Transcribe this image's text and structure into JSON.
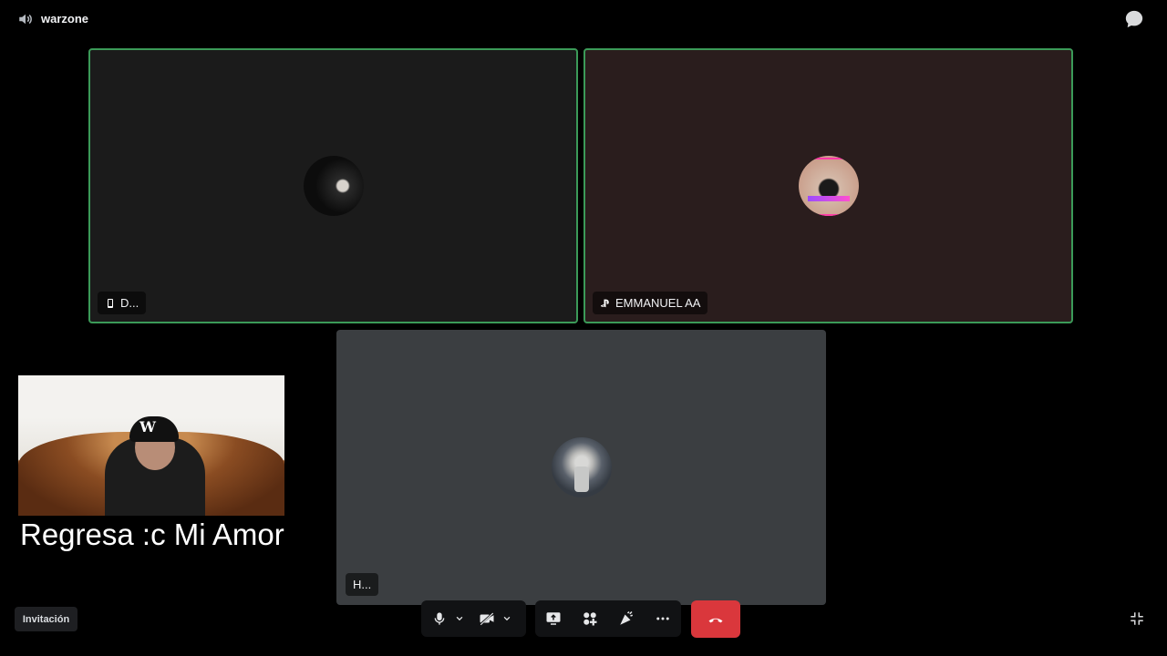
{
  "topbar": {
    "channel_name": "warzone"
  },
  "participants": [
    {
      "name": "D...",
      "platform": "mobile",
      "speaking": true
    },
    {
      "name": "EMMANUEL AA",
      "platform": "playstation",
      "speaking": true
    },
    {
      "name": "H...",
      "platform": "none",
      "speaking": false
    }
  ],
  "overlay": {
    "caption": "Regresa :c Mi Amor",
    "cap_logo": "W"
  },
  "footer": {
    "invite_label": "Invitación"
  },
  "controls": {
    "icons": [
      "microphone-icon",
      "chevron-down-icon",
      "camera-off-icon",
      "chevron-down-icon",
      "screen-share-icon",
      "activities-icon",
      "soundboard-icon",
      "more-icon",
      "hang-up-icon",
      "minimize-icon"
    ]
  },
  "colors": {
    "speaking_outline": "#3b9a58",
    "end_call": "#da373c",
    "background": "#000000"
  }
}
